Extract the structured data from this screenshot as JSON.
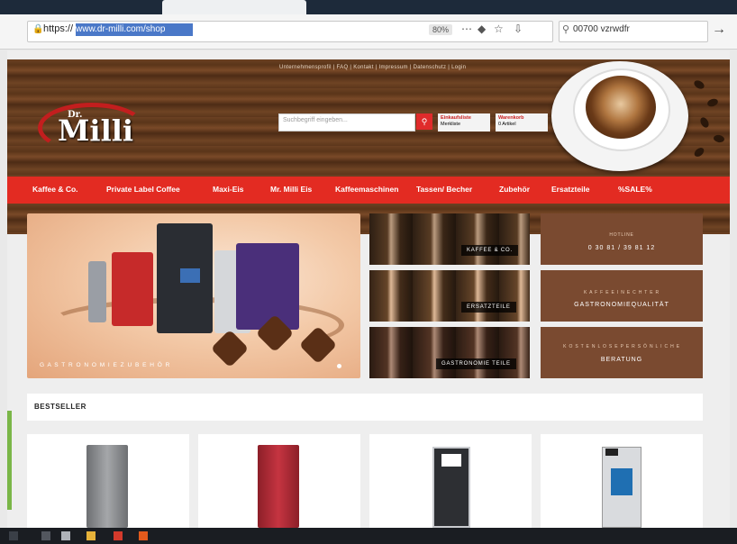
{
  "browser": {
    "url_prefix": "https://",
    "url_selected": "www.dr-milli.com/shop",
    "zoom": "80%",
    "search_text": "00700 vzrwdfr",
    "icons": {
      "lock": "lock-icon",
      "more": "more-icon",
      "pocket": "pocket-icon",
      "bookmark": "star-icon",
      "download": "download-icon",
      "search": "search-icon",
      "forward": "arrow-right-icon"
    }
  },
  "site": {
    "topnav": "Unternehmensprofil  |  FAQ  |  Kontakt  |  Impressum  |  Datenschutz  |  Login",
    "logo_small": "Dr.",
    "logo_text": "Milli",
    "search_placeholder": "Suchbegriff eingeben...",
    "account_1": {
      "title": "Einkaufsliste",
      "line": "Merkliste"
    },
    "account_2": {
      "title": "Warenkorb",
      "line": "0 Artikel"
    },
    "nav": [
      "Kaffee & Co.",
      "Private Label Coffee",
      "Maxi-Eis",
      "Mr. Milli Eis",
      "Kaffeemaschinen",
      "Tassen/ Becher",
      "Zubehör",
      "Ersatzteile",
      "%SALE%"
    ],
    "hero_caption": "G A S T R O N O M I E   Z U B E H Ö R",
    "tiles": [
      "KAFFEE & CO.",
      "ERSATZTEILE",
      "GASTRONOMIE TEILE"
    ],
    "brown_tiles": [
      {
        "small": "HOTLINE",
        "large": "0 30 81 / 39 81 12"
      },
      {
        "small": "K A F F E E   I N   E C H T E R",
        "large": "GASTRONOMIEQUALITÄT"
      },
      {
        "small": "K O S T E N L O S E   P E R S Ö N L I C H E",
        "large": "BERATUNG"
      }
    ],
    "bestseller_title": "BESTSELLER"
  }
}
